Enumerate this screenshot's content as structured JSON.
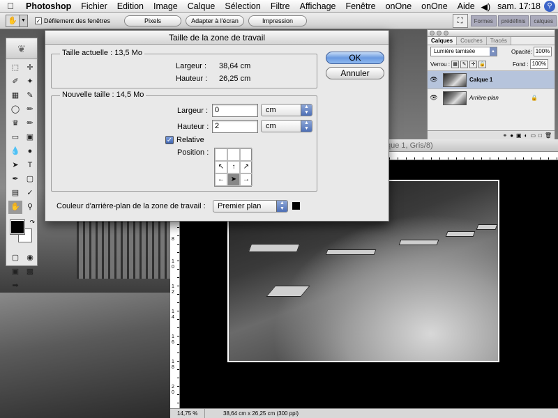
{
  "menubar": {
    "apple": "",
    "app": "Photoshop",
    "items": [
      "Fichier",
      "Edition",
      "Image",
      "Calque",
      "Sélection",
      "Filtre",
      "Affichage",
      "Fenêtre",
      "onOne",
      "onOne",
      "Aide"
    ],
    "clock": "sam. 17:18",
    "volume_icon": "◀)"
  },
  "optionsbar": {
    "scroll_all_label": "Défilement des fenêtres",
    "btn_pixels": "Pixels",
    "btn_fit": "Adapter à l'écran",
    "btn_print": "Impression",
    "dock_tabs": [
      "Formes",
      "prédéfinis",
      "calques"
    ]
  },
  "dialog": {
    "title": "Taille de la zone de travail",
    "current_size_label": "Taille actuelle : 13,5 Mo",
    "current_width_label": "Largeur :",
    "current_width_value": "38,64 cm",
    "current_height_label": "Hauteur :",
    "current_height_value": "26,25 cm",
    "new_size_label": "Nouvelle taille : 14,5 Mo",
    "width_label": "Largeur :",
    "width_value": "0",
    "width_unit": "cm",
    "height_label": "Hauteur :",
    "height_value": "2",
    "height_unit": "cm",
    "relative_label": "Relative",
    "relative_checked": true,
    "position_label": "Position :",
    "bg_color_label": "Couleur d'arrière-plan de la zone de travail :",
    "bg_color_value": "Premier plan",
    "ok_label": "OK",
    "cancel_label": "Annuler"
  },
  "layers_palette": {
    "tabs": [
      "Calques",
      "Couches",
      "Tracés"
    ],
    "blend_mode": "Lumière tamisée",
    "opacity_label": "Opacité:",
    "opacity_value": "100%",
    "lock_label": "Verrou :",
    "fill_label": "Fond :",
    "fill_value": "100%",
    "layers": [
      {
        "name": "Calque 1",
        "selected": true
      },
      {
        "name": "Arrière-plan",
        "selected": false
      }
    ]
  },
  "document": {
    "title_partial": "que 1, Gris/8)",
    "zoom": "14,75 %",
    "info": "38,64 cm x 26,25 cm (300 ppi)",
    "ruler_v_numbers": [
      "8",
      "1",
      "0",
      "1",
      "2",
      "1",
      "4",
      "1",
      "6",
      "1",
      "8",
      "2",
      "0"
    ]
  },
  "colors": {
    "accent": "#4d6fb6",
    "selection": "#b6c4dc"
  }
}
